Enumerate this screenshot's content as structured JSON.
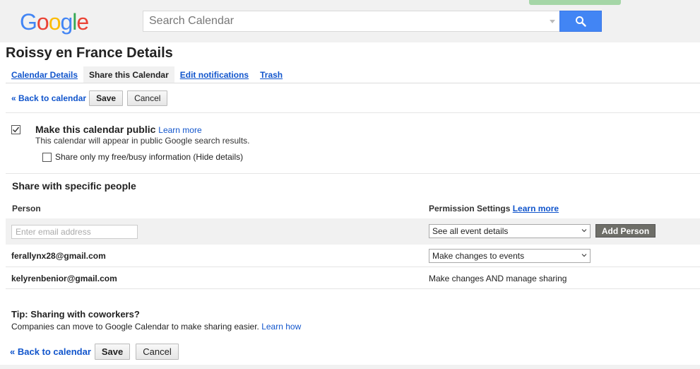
{
  "header": {
    "logo_letters": [
      {
        "ch": "G",
        "color": "#4285F4"
      },
      {
        "ch": "o",
        "color": "#EA4335"
      },
      {
        "ch": "o",
        "color": "#FBBC05"
      },
      {
        "ch": "g",
        "color": "#4285F4"
      },
      {
        "ch": "l",
        "color": "#34A853"
      },
      {
        "ch": "e",
        "color": "#EA4335"
      }
    ],
    "search_placeholder": "Search Calendar",
    "search_icon": "search-icon"
  },
  "page": {
    "title": "Roissy en France Details"
  },
  "tabs": [
    {
      "label": "Calendar Details",
      "active": false
    },
    {
      "label": "Share this Calendar",
      "active": true
    },
    {
      "label": "Edit notifications",
      "active": false
    },
    {
      "label": "Trash",
      "active": false
    }
  ],
  "actions": {
    "back_label": "« Back to calendar",
    "save_label": "Save",
    "cancel_label": "Cancel"
  },
  "public": {
    "checked": true,
    "title": "Make this calendar public",
    "learn_more": "Learn more",
    "description": "This calendar will appear in public Google search results.",
    "freebusy_checked": false,
    "freebusy_label": "Share only my free/busy information (Hide details)"
  },
  "share": {
    "heading": "Share with specific people",
    "col_person": "Person",
    "col_permission": "Permission Settings",
    "col_permission_learn_more": "Learn more",
    "email_placeholder": "Enter email address",
    "new_permission": "See all event details",
    "add_person_label": "Add Person",
    "people": [
      {
        "email": "ferallynx28@gmail.com",
        "permission": "Make changes to events",
        "editable": true
      },
      {
        "email": "kelyrenbenior@gmail.com",
        "permission": "Make changes AND manage sharing",
        "editable": false
      }
    ]
  },
  "tip": {
    "title": "Tip: Sharing with coworkers?",
    "text": "Companies can move to Google Calendar to make sharing easier.",
    "link": "Learn how"
  },
  "colors": {
    "accent_blue": "#4285f4",
    "link_blue": "#1155cc",
    "add_person_bg": "#6e6e68"
  }
}
